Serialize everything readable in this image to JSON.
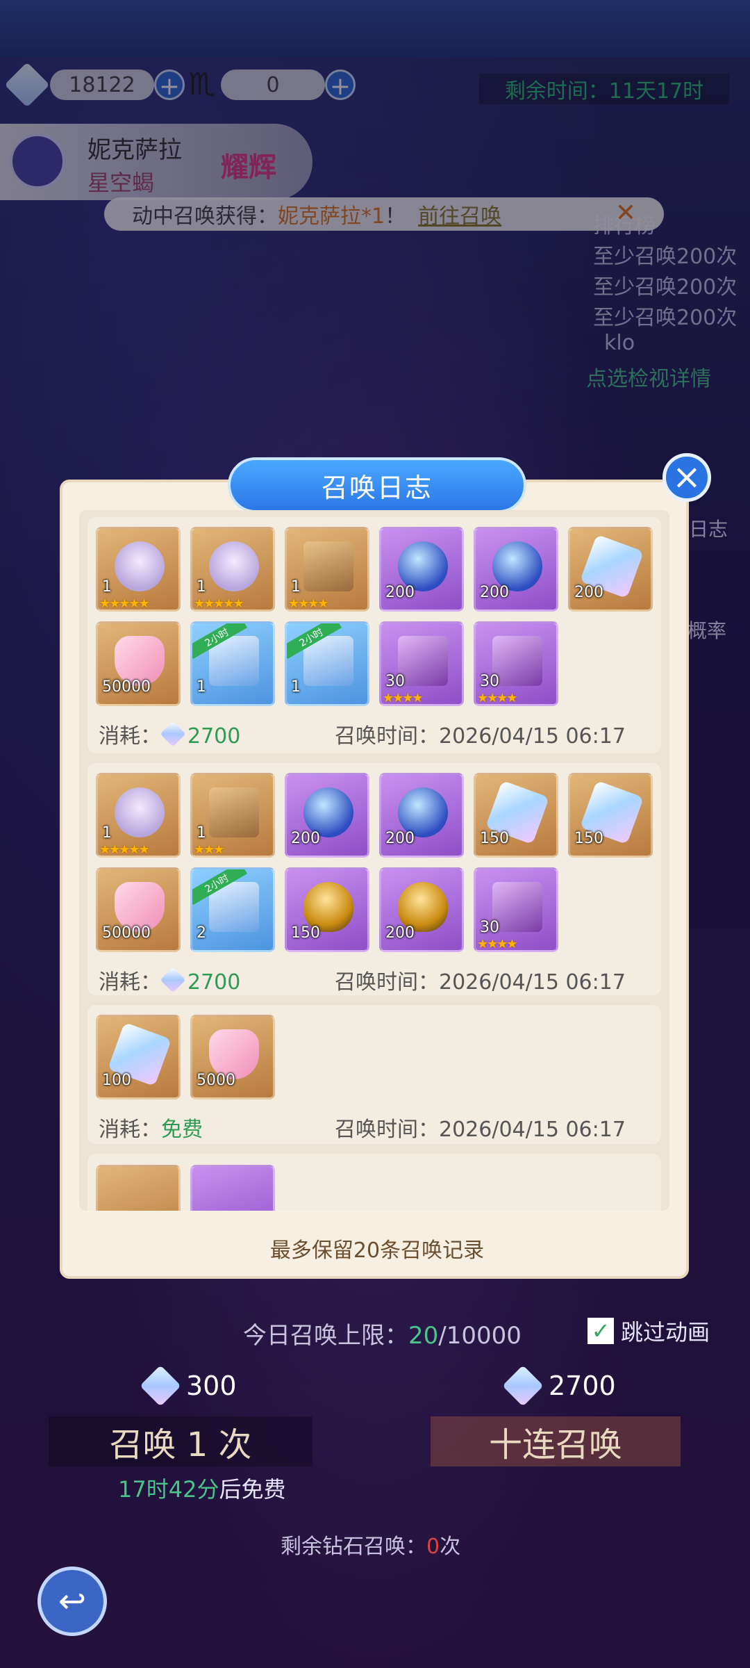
{
  "top": {
    "diamonds": "18122",
    "scorpions": "0",
    "timer": "剩余时间：11天17时"
  },
  "hero": {
    "name": "妮克萨拉",
    "subtitle": "星空蝎",
    "badge": "耀辉"
  },
  "notice": {
    "prefix": "动中召唤获得：",
    "highlight": "妮克萨拉*1",
    "suffix": "！",
    "link": "前往召唤"
  },
  "side": {
    "ranking": "排行榜",
    "items": [
      "至少召唤200次",
      "至少召唤200次",
      "至少召唤200次"
    ],
    "mini": "klo",
    "detail": "点选检视详情",
    "tab_log": "日志",
    "tab_rate": "概率"
  },
  "modal": {
    "title": "召唤日志",
    "footer": "最多保留20条召唤记录",
    "cost_label": "消耗：",
    "time_label": "召唤时间：",
    "records": [
      {
        "cost": "2700",
        "time": "2026/04/15 06:17",
        "items": [
          {
            "type": "hero",
            "qty": "1",
            "stars": "★★★★★",
            "rarity": "gold"
          },
          {
            "type": "hero",
            "qty": "1",
            "stars": "★★★★★",
            "rarity": "gold"
          },
          {
            "type": "chest",
            "qty": "1",
            "stars": "★★★★",
            "rarity": "gold"
          },
          {
            "type": "orb",
            "qty": "200",
            "rarity": "purple"
          },
          {
            "type": "orb",
            "qty": "200",
            "rarity": "purple"
          },
          {
            "type": "crystal",
            "qty": "200",
            "rarity": "gold"
          },
          {
            "type": "exp",
            "qty": "50000",
            "rarity": "gold"
          },
          {
            "type": "treasure",
            "qty": "1",
            "ribbon": "2小时",
            "rarity": "blue"
          },
          {
            "type": "treasure",
            "qty": "1",
            "ribbon": "2小时",
            "rarity": "blue"
          },
          {
            "type": "shard",
            "qty": "30",
            "stars": "★★★★",
            "rarity": "purple"
          },
          {
            "type": "shard",
            "qty": "30",
            "stars": "★★★★",
            "rarity": "purple"
          }
        ]
      },
      {
        "cost": "2700",
        "time": "2026/04/15 06:17",
        "items": [
          {
            "type": "hero",
            "qty": "1",
            "stars": "★★★★★",
            "rarity": "gold"
          },
          {
            "type": "chest",
            "qty": "1",
            "stars": "★★★",
            "rarity": "gold"
          },
          {
            "type": "orb",
            "qty": "200",
            "rarity": "purple"
          },
          {
            "type": "orb",
            "qty": "200",
            "rarity": "purple"
          },
          {
            "type": "crystal",
            "qty": "150",
            "rarity": "gold"
          },
          {
            "type": "crystal",
            "qty": "150",
            "rarity": "gold"
          },
          {
            "type": "exp",
            "qty": "50000",
            "rarity": "gold"
          },
          {
            "type": "treasure",
            "qty": "2",
            "ribbon": "2小时",
            "rarity": "blue"
          },
          {
            "type": "egg",
            "qty": "150",
            "rarity": "purple"
          },
          {
            "type": "egg",
            "qty": "200",
            "rarity": "purple"
          },
          {
            "type": "shard",
            "qty": "30",
            "stars": "★★★★",
            "rarity": "purple"
          }
        ]
      },
      {
        "cost": "免费",
        "time": "2026/04/15 06:17",
        "items": [
          {
            "type": "crystal",
            "qty": "100",
            "rarity": "gold"
          },
          {
            "type": "exp",
            "qty": "5000",
            "rarity": "gold"
          }
        ]
      }
    ]
  },
  "lower": {
    "limit_label": "今日召唤上限：",
    "limit_used": "20",
    "limit_total": "/10000",
    "skip": "跳过动画",
    "cost_single": "300",
    "cost_ten": "2700",
    "btn_single": "召唤 1 次",
    "btn_ten": "十连召唤",
    "free_time": "17时42分",
    "free_suffix": "后免费",
    "remain_prefix": "剩余钻石召唤：",
    "remain_count": "0",
    "remain_suffix": "次"
  },
  "colors": {
    "accent_blue": "#2b77e6",
    "cost_green": "#2f9a52",
    "notice_orange": "#e07b23"
  }
}
